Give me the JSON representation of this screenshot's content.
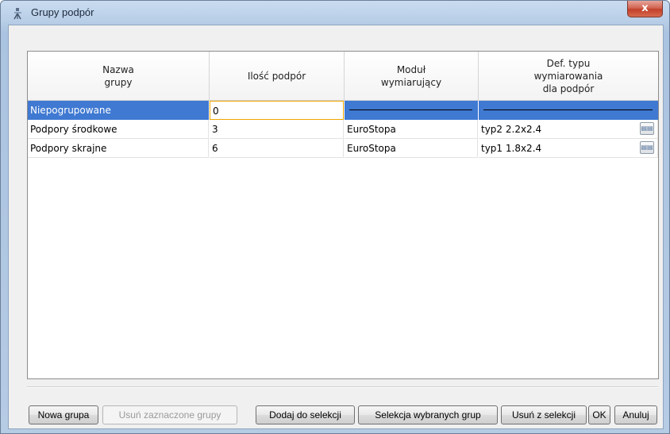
{
  "window": {
    "title": "Grupy podpór",
    "close_label": "x"
  },
  "table": {
    "columns": [
      "Nazwa\ngrupy",
      "Ilość podpór",
      "Moduł\nwymiarujący",
      "Def. typu\nwymiarowania\ndla podpór"
    ],
    "rows": [
      {
        "name": "Niepogrupowane",
        "count": "0",
        "module": "",
        "type": "",
        "selected": true
      },
      {
        "name": "Podpory środkowe",
        "count": "3",
        "module": "EuroStopa",
        "type": "typ2 2.2x2.4",
        "selected": false
      },
      {
        "name": "Podpory skrajne",
        "count": "6",
        "module": "EuroStopa",
        "type": "typ1 1.8x2.4",
        "selected": false
      }
    ]
  },
  "buttons": {
    "new_group": "Nowa grupa",
    "delete_selected": "Usuń zaznaczone grupy",
    "add_to_selection": "Dodaj do selekcji",
    "select_groups": "Selekcja wybranych grup",
    "remove_from_selection": "Usuń z selekcji",
    "ok": "OK",
    "cancel": "Anuluj"
  },
  "colors": {
    "selection": "#3f79d2",
    "edit_border": "#f0a500"
  }
}
